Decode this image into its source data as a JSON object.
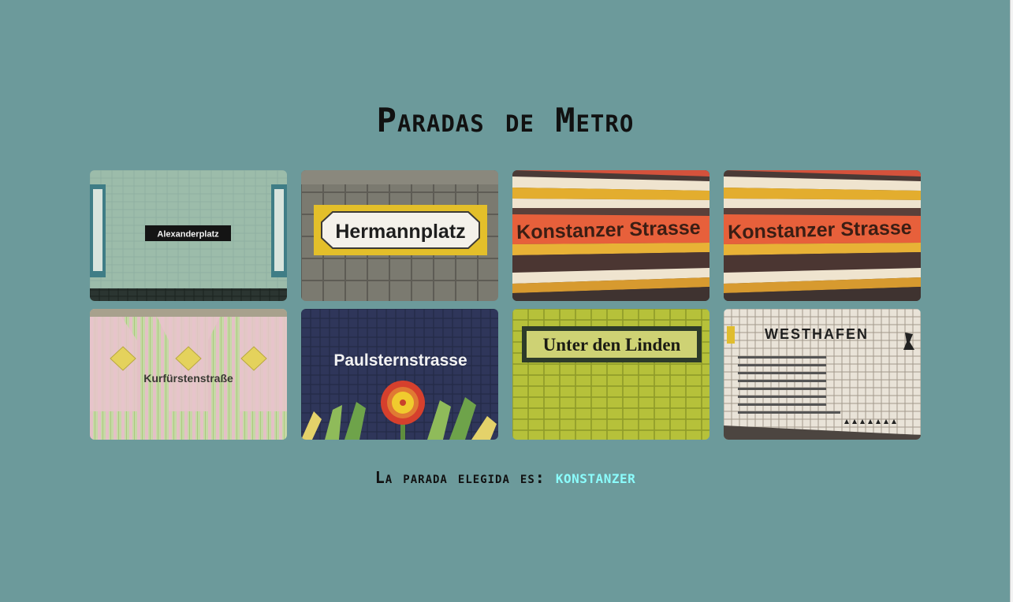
{
  "page": {
    "title": "Paradas de Metro"
  },
  "stations": [
    {
      "label": "Alexanderplatz"
    },
    {
      "label": "Hermannplatz"
    },
    {
      "label": "Konstanzer Strasse"
    },
    {
      "label": "Konstanzer Strasse"
    },
    {
      "label": "Kurfürstenstraße"
    },
    {
      "label": "Paulsternstrasse"
    },
    {
      "label": "Unter den Linden"
    },
    {
      "label": "WESTHAFEN"
    }
  ],
  "selection": {
    "prefix": "La parada elegida es:",
    "value": "KONSTANZER"
  },
  "colors": {
    "background": "#6c9a9b",
    "selected_value": "#8bfcfc"
  }
}
